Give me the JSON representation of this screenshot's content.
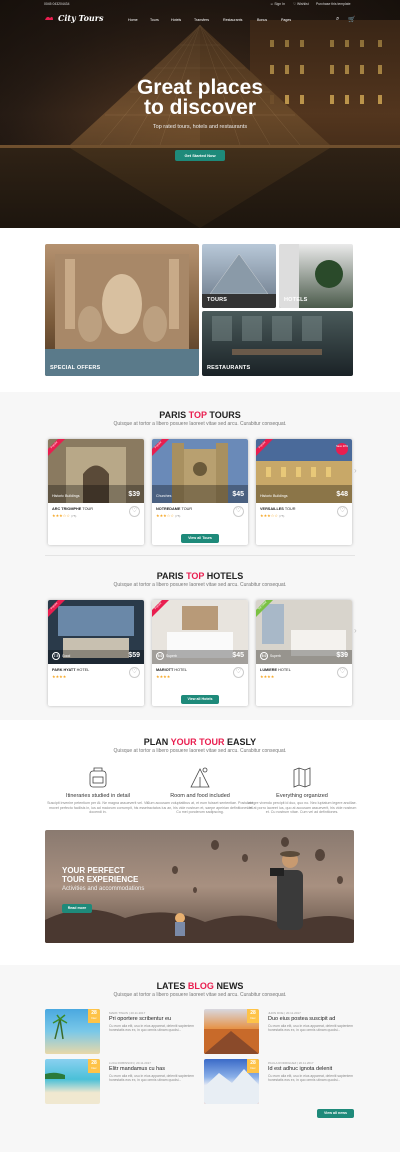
{
  "topbar": {
    "phone": "0045 043204434",
    "sign_in": "Sign In",
    "wishlist": "Wishlist",
    "purchase": "Purchase this template"
  },
  "brand": {
    "logo": "City Tours",
    "accent": "#e91e4f",
    "green": "#1e8a7a"
  },
  "nav": {
    "items": [
      "Home",
      "Tours",
      "Hotels",
      "Transfers",
      "Restaurants",
      "Bonus",
      "Pages"
    ]
  },
  "hero": {
    "title_line1": "Great places",
    "title_line2": "to discover",
    "subtitle": "Top rated tours, hotels and restaurants",
    "cta": "Get Started Now"
  },
  "tiles": {
    "special": "SPECIAL OFFERS",
    "tours": "TOURS",
    "hotels": "HOTELS",
    "restaurants": "RESTAURANTS"
  },
  "tours_section": {
    "title_pre": "PARIS",
    "title_hl": "TOP",
    "title_post": "TOURS",
    "subtitle": "Quisque at tortor a libero posuere laoreet vitae sed arcu. Curabitur consequat.",
    "button": "View all Tours",
    "cards": [
      {
        "ribbon": "Popular",
        "category": "Historic Buildings",
        "price": "$39",
        "name_bold": "ARC TRIOMPHE",
        "name_rest": "TOUR",
        "stars": "★★★☆☆",
        "reviews": "(75)"
      },
      {
        "ribbon": "Popular",
        "category": "Churches",
        "price": "$45",
        "name_bold": "NOTREDAME",
        "name_rest": "TOUR",
        "stars": "★★★☆☆",
        "reviews": "(75)",
        "badge": "Save 20%"
      },
      {
        "ribbon": "Popular",
        "category": "Historic Buildings",
        "price": "$48",
        "name_bold": "VERSAILLES",
        "name_rest": "TOUR",
        "stars": "★★★☆☆",
        "reviews": "(75)"
      }
    ]
  },
  "hotels_section": {
    "title_pre": "PARIS",
    "title_hl": "TOP",
    "title_post": "HOTELS",
    "subtitle": "Quisque at tortor a libero posuere laoreet vitae sed arcu. Curabitur consequat.",
    "button": "View all Hotels",
    "cards": [
      {
        "ribbon": "Popular",
        "score": "7.5",
        "score_label": "Good",
        "price": "$59",
        "name_bold": "PARK HYATT",
        "name_rest": "HOTEL",
        "stars": "★★★★"
      },
      {
        "ribbon": "Popular",
        "score": "9.0",
        "score_label": "Superb",
        "price": "$45",
        "name_bold": "MARIOTT",
        "name_rest": "HOTEL",
        "stars": "★★★★"
      },
      {
        "ribbon": "Top rated",
        "score": "9.0",
        "score_label": "Superb",
        "price": "$39",
        "name_bold": "LUMIERE",
        "name_rest": "HOTEL",
        "stars": "★★★★"
      }
    ]
  },
  "plan_section": {
    "title_pre": "PLAN",
    "title_hl": "YOUR TOUR",
    "title_post": "EASLY",
    "subtitle": "Quisque at tortor a libero posuere laoreet vitae sed arcu. Curabitur consequat.",
    "features": [
      {
        "icon": "backpack-icon",
        "title": "Itineraries studied in detail",
        "text": "Suscipit invenire petentium per At. Ne magna assueverit vel. Vix movet perfecto facilisis in, ius ad maiorum corrumpit, his esse docendi in."
      },
      {
        "icon": "tent-icon",
        "title": "Room and food included",
        "text": "Cum accusam voluptatibus at, et eum fuisset sententiae. Postulant tractatos ius an, his vide nostrum et, saepe apeirian definitiones et. Cu mei ponderum sadipscing."
      },
      {
        "icon": "map-icon",
        "title": "Everything organized",
        "text": "Integre vivendo percipit id duo, quo no. Nec luptatum legere ancillae. Vel at porro laoreet ius, quo at accusam assueverit, his vide nostrum et. Cu nostrum vitae. Cum vel ad definitiones."
      }
    ],
    "banner_title1": "YOUR PERFECT",
    "banner_title2": "TOUR EXPERIENCE",
    "banner_sub": "Activities and accommodations",
    "banner_btn": "Read more"
  },
  "blog_section": {
    "title_pre": "LATES",
    "title_hl": "BLOG",
    "title_post": "NEWS",
    "subtitle": "Quisque at tortor a libero posuere laoreet vitae sed arcu. Curabitur consequat.",
    "button": "View all news",
    "posts": [
      {
        "day": "28",
        "month": "Dec",
        "meta": "MARK TWAIN  |  20.11.2017",
        "title": "Pri oportere scribentur eu",
        "text": "Cu eum alia elit, usu in eius appareat, deleniti sapientem honestatis eos ex, in quo omnis utinam quodsi..."
      },
      {
        "day": "28",
        "month": "Dec",
        "meta": "JHON DOE  |  20.11.2017",
        "title": "Duo eius postea suscipit ad",
        "text": "Cu eum alia elit, usu in eius appareat, deleniti sapientem honestatis eos ex, in quo omnis utinam quodsi..."
      },
      {
        "day": "28",
        "month": "Dec",
        "meta": "LUCA ROBINSON  |  20.11.2017",
        "title": "Elitr mandamus cu has",
        "text": "Cu eum alia elit, usu in eius appareat, deleniti sapientem honestatis eos ex, in quo omnis utinam quodsi..."
      },
      {
        "day": "28",
        "month": "Dec",
        "meta": "PAULA RODRIGUEZ  |  20.11.2017",
        "title": "Id est adhuc ignota delenit",
        "text": "Cu eum alia elit, usu in eius appareat, deleniti sapientem honestatis eos ex, in quo omnis utinam quodsi..."
      }
    ]
  }
}
